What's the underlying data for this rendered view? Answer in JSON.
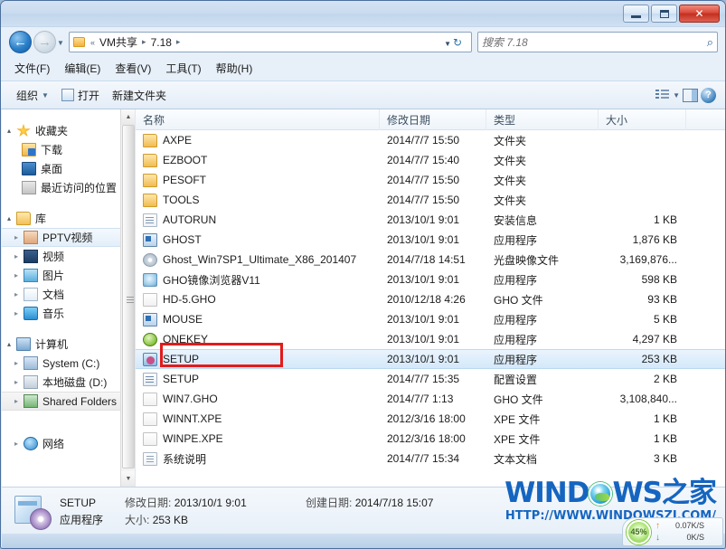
{
  "window": {
    "titlebar": {
      "minimize_label": "–",
      "maximize_label": "□",
      "close_label": "✕"
    }
  },
  "addressbar": {
    "back_icon": "←",
    "forward_icon": "→",
    "history_caret": "▼",
    "separator": "«",
    "crumbs": [
      {
        "label": "VM共享",
        "arrow": "▸"
      },
      {
        "label": "7.18",
        "arrow": "▸"
      }
    ],
    "dropdown_caret": "▼",
    "refresh_icon": "↻"
  },
  "search": {
    "placeholder": "搜索 7.18",
    "icon": "⌕"
  },
  "menubar": {
    "items": [
      "文件(F)",
      "编辑(E)",
      "查看(V)",
      "工具(T)",
      "帮助(H)"
    ]
  },
  "toolbar": {
    "organize_label": "组织",
    "organize_caret": "▼",
    "open_label": "打开",
    "new_folder_label": "新建文件夹",
    "view_caret": "▼",
    "help_label": "?"
  },
  "sidebar": {
    "groups": [
      {
        "header": {
          "label": "收藏夹",
          "icon": "star-icon",
          "expander": "▴",
          "icon_class": "ico-star"
        },
        "items": [
          {
            "label": "下载",
            "icon": "downloads-icon",
            "icon_class": "ico-dl",
            "expander": ""
          },
          {
            "label": "桌面",
            "icon": "desktop-icon",
            "icon_class": "ico-desk",
            "expander": ""
          },
          {
            "label": "最近访问的位置",
            "icon": "recent-places-icon",
            "icon_class": "ico-recent",
            "expander": ""
          }
        ]
      },
      {
        "header": {
          "label": "库",
          "icon": "library-icon",
          "expander": "▴",
          "icon_class": "ico-lib"
        },
        "items": [
          {
            "label": "PPTV视频",
            "icon": "pptv-icon",
            "icon_class": "ico-pptv",
            "expander": "▸",
            "selected": true
          },
          {
            "label": "视频",
            "icon": "videos-icon",
            "icon_class": "ico-video",
            "expander": "▸"
          },
          {
            "label": "图片",
            "icon": "pictures-icon",
            "icon_class": "ico-pic",
            "expander": "▸"
          },
          {
            "label": "文档",
            "icon": "documents-icon",
            "icon_class": "ico-doc",
            "expander": "▸"
          },
          {
            "label": "音乐",
            "icon": "music-icon",
            "icon_class": "ico-music",
            "expander": "▸"
          }
        ]
      },
      {
        "header": {
          "label": "计算机",
          "icon": "computer-icon",
          "expander": "▴",
          "icon_class": "ico-comp"
        },
        "items": [
          {
            "label": "System (C:)",
            "icon": "drive-c-icon",
            "icon_class": "ico-drvc",
            "expander": "▸"
          },
          {
            "label": "本地磁盘 (D:)",
            "icon": "drive-d-icon",
            "icon_class": "ico-drvd",
            "expander": "▸"
          },
          {
            "label": "Shared Folders",
            "icon": "shared-folders-icon",
            "icon_class": "ico-shared",
            "expander": "▸",
            "selected2": true
          }
        ]
      },
      {
        "header": null,
        "items": [
          {
            "label": "网络",
            "icon": "network-icon",
            "icon_class": "ico-net",
            "expander": "▸"
          }
        ]
      }
    ],
    "scrollbar": {
      "up_arrow": "▲",
      "down_arrow": "▼"
    }
  },
  "filelist": {
    "columns": [
      {
        "key": "name",
        "label": "名称"
      },
      {
        "key": "date",
        "label": "修改日期"
      },
      {
        "key": "type",
        "label": "类型"
      },
      {
        "key": "size",
        "label": "大小"
      }
    ],
    "rows": [
      {
        "name": "AXPE",
        "date": "2014/7/7 15:50",
        "type": "文件夹",
        "size": "",
        "icon": "folder-icon",
        "icon_class": "f-folder"
      },
      {
        "name": "EZBOOT",
        "date": "2014/7/7 15:40",
        "type": "文件夹",
        "size": "",
        "icon": "folder-icon",
        "icon_class": "f-folder"
      },
      {
        "name": "PESOFT",
        "date": "2014/7/7 15:50",
        "type": "文件夹",
        "size": "",
        "icon": "folder-icon",
        "icon_class": "f-folder"
      },
      {
        "name": "TOOLS",
        "date": "2014/7/7 15:50",
        "type": "文件夹",
        "size": "",
        "icon": "folder-icon",
        "icon_class": "f-folder"
      },
      {
        "name": "AUTORUN",
        "date": "2013/10/1 9:01",
        "type": "安装信息",
        "size": "1 KB",
        "icon": "setup-information-icon",
        "icon_class": "f-inf"
      },
      {
        "name": "GHOST",
        "date": "2013/10/1 9:01",
        "type": "应用程序",
        "size": "1,876 KB",
        "icon": "application-icon",
        "icon_class": "f-exe"
      },
      {
        "name": "Ghost_Win7SP1_Ultimate_X86_201407",
        "date": "2014/7/18 14:51",
        "type": "光盘映像文件",
        "size": "3,169,876...",
        "icon": "disc-image-icon",
        "icon_class": "f-iso"
      },
      {
        "name": "GHO镜像浏览器V11",
        "date": "2013/10/1 9:01",
        "type": "应用程序",
        "size": "598 KB",
        "icon": "application-icon",
        "icon_class": "f-ghoview"
      },
      {
        "name": "HD-5.GHO",
        "date": "2010/12/18 4:26",
        "type": "GHO 文件",
        "size": "93 KB",
        "icon": "gho-file-icon",
        "icon_class": "f-gho"
      },
      {
        "name": "MOUSE",
        "date": "2013/10/1 9:01",
        "type": "应用程序",
        "size": "5 KB",
        "icon": "application-icon",
        "icon_class": "f-exe"
      },
      {
        "name": "ONEKEY",
        "date": "2013/10/1 9:01",
        "type": "应用程序",
        "size": "4,297 KB",
        "icon": "application-icon",
        "icon_class": "f-onekey"
      },
      {
        "name": "SETUP",
        "date": "2013/10/1 9:01",
        "type": "应用程序",
        "size": "253 KB",
        "icon": "application-icon",
        "icon_class": "f-setupapp",
        "selected": true
      },
      {
        "name": "SETUP",
        "date": "2014/7/7 15:35",
        "type": "配置设置",
        "size": "2 KB",
        "icon": "configuration-icon",
        "icon_class": "f-cfg"
      },
      {
        "name": "WIN7.GHO",
        "date": "2014/7/7 1:13",
        "type": "GHO 文件",
        "size": "3,108,840...",
        "icon": "gho-file-icon",
        "icon_class": "f-gho"
      },
      {
        "name": "WINNT.XPE",
        "date": "2012/3/16 18:00",
        "type": "XPE 文件",
        "size": "1 KB",
        "icon": "xpe-file-icon",
        "icon_class": "f-gho"
      },
      {
        "name": "WINPE.XPE",
        "date": "2012/3/16 18:00",
        "type": "XPE 文件",
        "size": "1 KB",
        "icon": "xpe-file-icon",
        "icon_class": "f-gho"
      },
      {
        "name": "系统说明",
        "date": "2014/7/7 15:34",
        "type": "文本文档",
        "size": "3 KB",
        "icon": "text-document-icon",
        "icon_class": "f-txt"
      }
    ]
  },
  "details_pane": {
    "file_name": "SETUP",
    "modified_label": "修改日期:",
    "modified_value": "2013/10/1 9:01",
    "created_label": "创建日期:",
    "created_value": "2014/7/18 15:07",
    "type_value": "应用程序",
    "size_label": "大小:",
    "size_value": "253 KB"
  },
  "watermark": {
    "brand_left": "WIND",
    "brand_right": "WS之家",
    "url": "HTTP://WWW.WINDOWSZJ.COM/"
  },
  "network_widget": {
    "percent": "45%",
    "upload_arrow": "↑",
    "upload_value": "0.07K/S",
    "download_arrow": "↓",
    "download_value": "0K/S"
  },
  "colors": {
    "accent": "#1565c0",
    "highlight_rect": "#e21b1b",
    "selection": "#d4e8fa",
    "close_button": "#c22f20"
  }
}
